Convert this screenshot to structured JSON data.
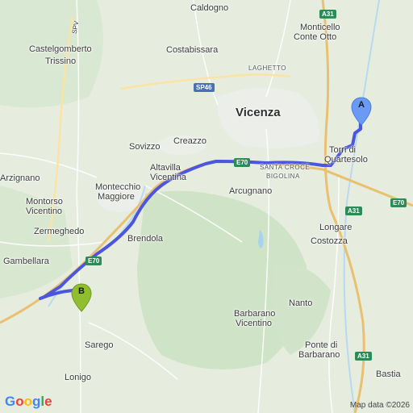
{
  "map": {
    "places": [
      {
        "id": "caldogno",
        "name": "Caldogno",
        "cls": "town"
      },
      {
        "id": "monticello",
        "name": "Monticello",
        "cls": "town"
      },
      {
        "id": "conte-otto",
        "name": "Conte Otto",
        "cls": "town"
      },
      {
        "id": "castelgomberto",
        "name": "Castelgomberto",
        "cls": "town"
      },
      {
        "id": "costabissara",
        "name": "Costabissara",
        "cls": "town"
      },
      {
        "id": "laghetto",
        "name": "LAGHETTO",
        "cls": "small"
      },
      {
        "id": "trissino",
        "name": "Trissino",
        "cls": "town"
      },
      {
        "id": "vicenza",
        "name": "Vicenza",
        "cls": "city"
      },
      {
        "id": "creazzo",
        "name": "Creazzo",
        "cls": "town"
      },
      {
        "id": "sovizzo",
        "name": "Sovizzo",
        "cls": "town"
      },
      {
        "id": "torri",
        "name": "Torri di",
        "cls": "town"
      },
      {
        "id": "quartesolo",
        "name": "Quartesolo",
        "cls": "town"
      },
      {
        "id": "altavilla",
        "name": "Altavilla",
        "cls": "town"
      },
      {
        "id": "vicentina",
        "name": "Vicentina",
        "cls": "town"
      },
      {
        "id": "santa-croce",
        "name": "SANTA CROCE",
        "cls": "small"
      },
      {
        "id": "bigolina",
        "name": "BIGOLINA",
        "cls": "small"
      },
      {
        "id": "arzignano",
        "name": "Arzignano",
        "cls": "town"
      },
      {
        "id": "montecchio",
        "name": "Montecchio",
        "cls": "town"
      },
      {
        "id": "maggiore",
        "name": "Maggiore",
        "cls": "town"
      },
      {
        "id": "arcugnano",
        "name": "Arcugnano",
        "cls": "town"
      },
      {
        "id": "montorso",
        "name": "Montorso",
        "cls": "town"
      },
      {
        "id": "vicentino",
        "name": "Vicentino",
        "cls": "town"
      },
      {
        "id": "longare",
        "name": "Longare",
        "cls": "town"
      },
      {
        "id": "costozza",
        "name": "Costozza",
        "cls": "town"
      },
      {
        "id": "zermeghedo",
        "name": "Zermeghedo",
        "cls": "town"
      },
      {
        "id": "brendola",
        "name": "Brendola",
        "cls": "town"
      },
      {
        "id": "gambellara",
        "name": "Gambellara",
        "cls": "town"
      },
      {
        "id": "nanto",
        "name": "Nanto",
        "cls": "town"
      },
      {
        "id": "barbarano",
        "name": "Barbarano",
        "cls": "town"
      },
      {
        "id": "vicentino2",
        "name": "Vicentino",
        "cls": "town"
      },
      {
        "id": "sarego",
        "name": "Sarego",
        "cls": "town"
      },
      {
        "id": "ponte-di",
        "name": "Ponte di",
        "cls": "town"
      },
      {
        "id": "barbarano2",
        "name": "Barbarano",
        "cls": "town"
      },
      {
        "id": "lonigo",
        "name": "Lonigo",
        "cls": "town"
      },
      {
        "id": "bastia",
        "name": "Bastia",
        "cls": "town"
      }
    ],
    "shields": [
      {
        "id": "a31-top",
        "text": "A31",
        "color": "green"
      },
      {
        "id": "sp46",
        "text": "SP46",
        "color": "blue"
      },
      {
        "id": "e70-mid",
        "text": "E70",
        "color": "green"
      },
      {
        "id": "a31-mid",
        "text": "A31",
        "color": "green"
      },
      {
        "id": "e70-right",
        "text": "E70",
        "color": "green"
      },
      {
        "id": "e70-left",
        "text": "E70",
        "color": "green"
      },
      {
        "id": "a31-bottom",
        "text": "A31",
        "color": "green"
      }
    ],
    "road_label": "SPV",
    "markers": [
      {
        "id": "A",
        "label": "A",
        "color": "#6b9af5"
      },
      {
        "id": "B",
        "label": "B",
        "color": "#8fbf2e"
      }
    ],
    "route_color": "#4b55dd",
    "attribution": "Map data ©2026"
  }
}
